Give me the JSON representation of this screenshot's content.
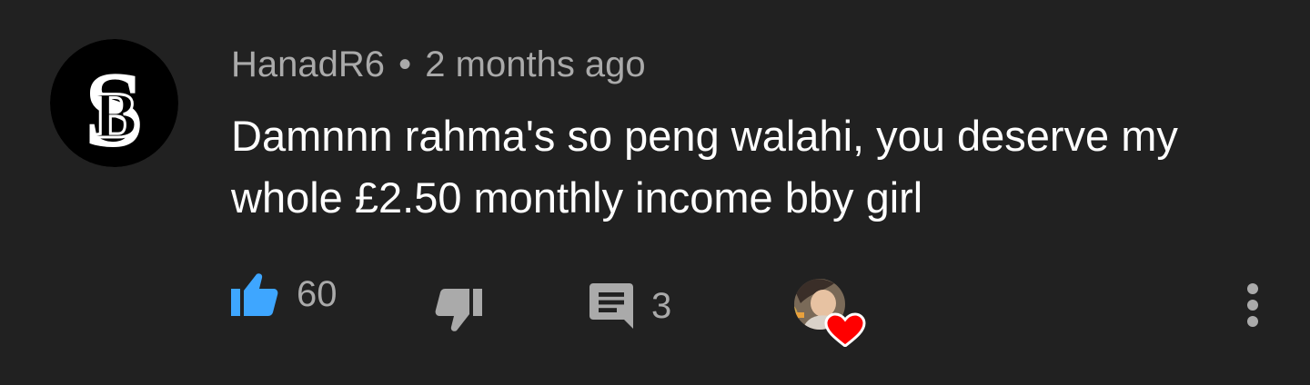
{
  "comment": {
    "author": "HanadR6",
    "separator": "•",
    "timestamp": "2 months ago",
    "text": "Damnnn rahma's so peng walahi, you deserve my whole £2.50 monthly income bby girl",
    "like_count": "60",
    "reply_count": "3",
    "avatar_icon": "sb-monogram-avatar",
    "creator_heart_icon": "creator-heart-icon"
  },
  "colors": {
    "background": "#212121",
    "text_primary": "#ffffff",
    "text_secondary": "#aaaaaa",
    "like_active": "#3ea6ff",
    "heart": "#ff0000"
  }
}
